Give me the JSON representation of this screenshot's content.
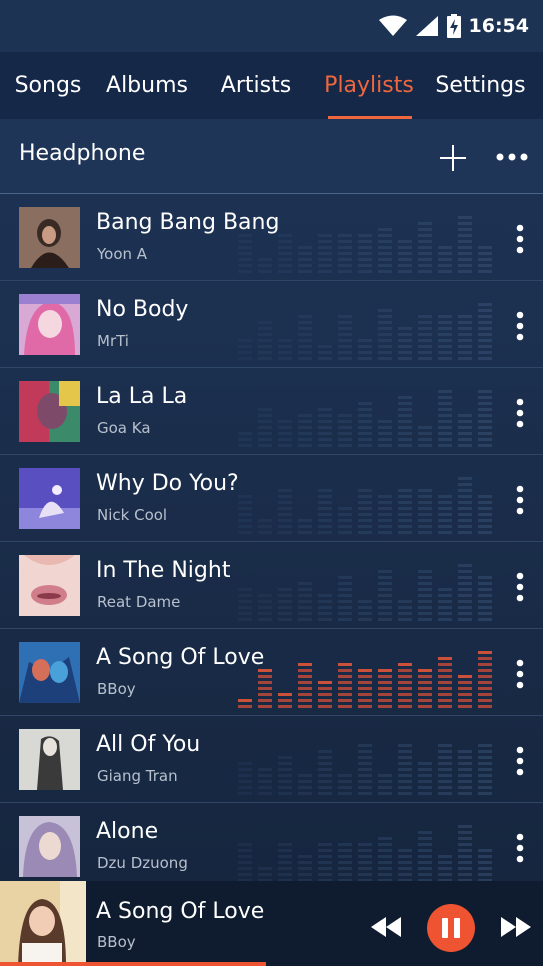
{
  "status_bar": {
    "time": "16:54",
    "icons": [
      "wifi-icon",
      "signal-icon",
      "battery-charging-icon"
    ]
  },
  "tabs": [
    {
      "label": "Songs",
      "active": false
    },
    {
      "label": "Albums",
      "active": false
    },
    {
      "label": "Artists",
      "active": false
    },
    {
      "label": "Playlists",
      "active": true
    },
    {
      "label": "Settings",
      "active": false
    }
  ],
  "header": {
    "title": "Headphone",
    "icons": [
      "plus-icon",
      "more-horizontal-icon"
    ]
  },
  "songs": [
    {
      "title": "Bang Bang Bang",
      "artist": "Yoon A",
      "playing": false
    },
    {
      "title": "No Body",
      "artist": "MrTi",
      "playing": false
    },
    {
      "title": "La La La",
      "artist": "Goa Ka",
      "playing": false
    },
    {
      "title": "Why Do You?",
      "artist": "Nick Cool",
      "playing": false
    },
    {
      "title": "In The Night",
      "artist": "Reat Dame",
      "playing": false
    },
    {
      "title": "A Song Of Love",
      "artist": "BBoy",
      "playing": true
    },
    {
      "title": "All Of You",
      "artist": "Giang Tran",
      "playing": false
    },
    {
      "title": "Alone",
      "artist": "Dzu Dzuong",
      "playing": false
    }
  ],
  "now_playing": {
    "title": "A Song Of Love",
    "artist": "BBoy",
    "state": "playing",
    "progress": 0.49,
    "controls": [
      "rewind-icon",
      "pause-icon",
      "fast-forward-icon"
    ]
  },
  "colors": {
    "accent": "#f0673e",
    "background": "#1a2c47",
    "tab_bar": "#152848",
    "player_bar": "#0f1c30"
  }
}
